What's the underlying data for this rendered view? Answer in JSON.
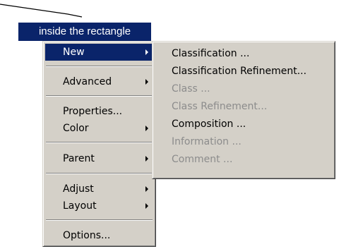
{
  "label": {
    "text": "inside the rectangle"
  },
  "menu": {
    "items": [
      {
        "label": "New",
        "has_submenu": true,
        "selected": true
      },
      {
        "label": "Advanced",
        "has_submenu": true
      },
      {
        "label": "Properties..."
      },
      {
        "label": "Color",
        "has_submenu": true
      },
      {
        "label": "Parent",
        "has_submenu": true
      },
      {
        "label": "Adjust",
        "has_submenu": true
      },
      {
        "label": "Layout",
        "has_submenu": true
      },
      {
        "label": "Options..."
      }
    ]
  },
  "submenu": {
    "items": [
      {
        "label": "Classification ...",
        "enabled": true
      },
      {
        "label": "Classification Refinement...",
        "enabled": true
      },
      {
        "label": "Class ...",
        "enabled": false
      },
      {
        "label": "Class Refinement...",
        "enabled": false
      },
      {
        "label": "Composition ...",
        "enabled": true
      },
      {
        "label": "Information ...",
        "enabled": false
      },
      {
        "label": "Comment ...",
        "enabled": false
      }
    ]
  },
  "colors": {
    "highlight": "#0a246a",
    "menu_face": "#d4d0c8",
    "disabled_text": "#8c8c8c"
  }
}
